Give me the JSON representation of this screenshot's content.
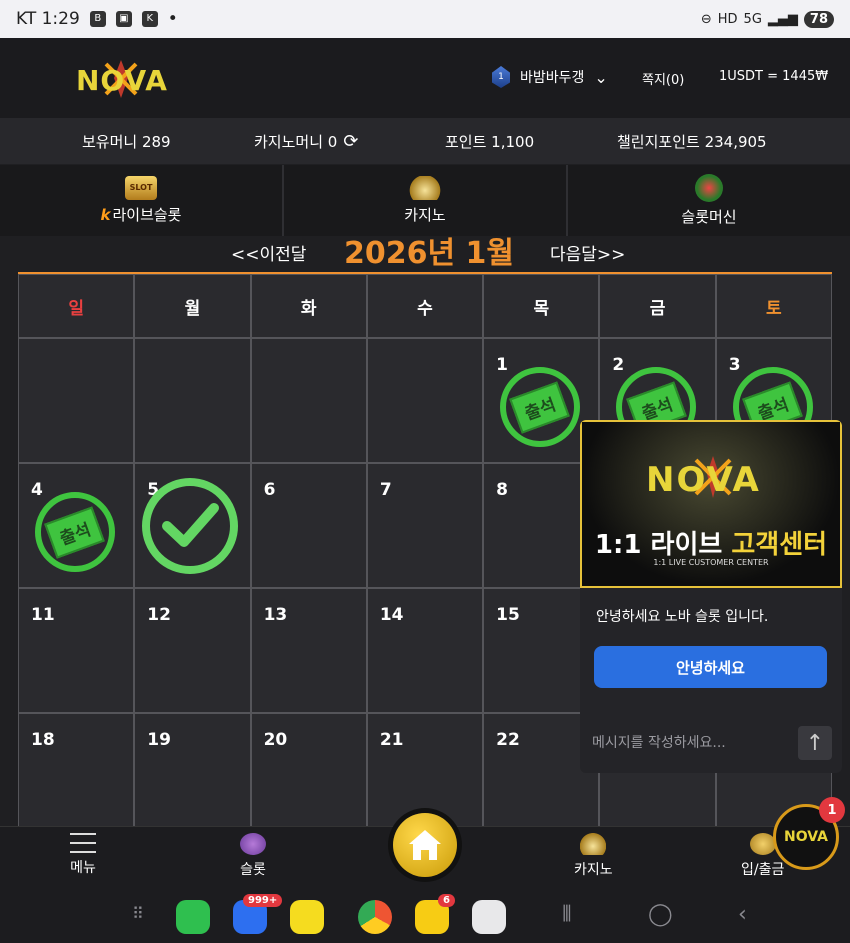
{
  "statusbar": {
    "carrier_time": "KT 1:29",
    "dot": "•",
    "battery": "78"
  },
  "header": {
    "logo": "NOVA",
    "user_name": "바밤바두갱",
    "rank": "1",
    "message_label": "쪽지(0)",
    "rate": "1USDT = 1445₩"
  },
  "balances": {
    "holding_money": "보유머니 289",
    "casino_money": "카지노머니 0",
    "points": "포인트 1,100",
    "challenge_points": "챌린지포인트 234,905"
  },
  "categories": [
    {
      "label": "라이브슬롯",
      "icon": "slot-icon"
    },
    {
      "label": "카지노",
      "icon": "casino-crown-icon"
    },
    {
      "label": "슬롯머신",
      "icon": "slot-machine-icon"
    }
  ],
  "calendar": {
    "prev_label": "<<이전달",
    "next_label": "다음달>>",
    "month_title": "2026년 1월",
    "weekdays": [
      "일",
      "월",
      "화",
      "수",
      "목",
      "금",
      "토"
    ],
    "stamp_label": "출석",
    "weeks": [
      [
        "",
        "",
        "",
        "",
        "1",
        "2",
        "3"
      ],
      [
        "4",
        "5",
        "6",
        "7",
        "8",
        "",
        ""
      ],
      [
        "11",
        "12",
        "13",
        "14",
        "15",
        "",
        ""
      ],
      [
        "18",
        "19",
        "20",
        "21",
        "22",
        "",
        ""
      ]
    ],
    "stamped_days": [
      "1",
      "2",
      "3",
      "4"
    ],
    "checked_days": [
      "5"
    ]
  },
  "chat": {
    "logo": "NOVA",
    "title_prefix": "1:1 라이브 ",
    "title_highlight": "고객센터",
    "subtitle": "1:1 LIVE CUSTOMER CENTER",
    "greeting": "안녕하세요 노바 슬롯 입니다.",
    "quick_reply": "안녕하세요",
    "input_placeholder": "메시지를 작성하세요..."
  },
  "bottomnav": {
    "menu": "메뉴",
    "slot": "슬롯",
    "casino": "카지노",
    "deposit": "입/출금"
  },
  "floating": {
    "logo": "NOVA",
    "badge": "1"
  },
  "dock": {
    "messages_badge": "999+",
    "b_badge": "6"
  },
  "colors": {
    "accent": "#f0912f",
    "stamp": "#3fc43f",
    "sunday": "#e94040",
    "chat_button": "#2a6fe0"
  }
}
